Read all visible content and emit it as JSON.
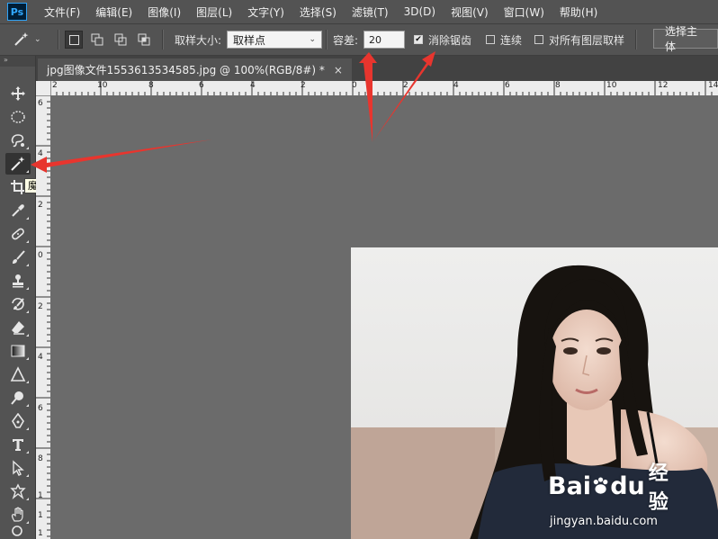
{
  "app": {
    "logo": "Ps"
  },
  "menu": [
    "文件(F)",
    "编辑(E)",
    "图像(I)",
    "图层(L)",
    "文字(Y)",
    "选择(S)",
    "滤镜(T)",
    "3D(D)",
    "视图(V)",
    "窗口(W)",
    "帮助(H)"
  ],
  "options": {
    "sample_size_label": "取样大小:",
    "sample_size_value": "取样点",
    "tolerance_label": "容差:",
    "tolerance_value": "20",
    "antialias_label": "消除锯齿",
    "antialias_checked": true,
    "contiguous_label": "连续",
    "contiguous_checked": false,
    "sample_all_layers_label": "对所有图层取样",
    "sample_all_layers_checked": false,
    "select_subject_label": "选择主体"
  },
  "tools_header": "»",
  "tooltip": "魔棒工具 (W)",
  "document": {
    "tab_title": "jpg图像文件1553613534585.jpg @ 100%(RGB/8#) *",
    "close": "×"
  },
  "ruler": {
    "h_labels": [
      "2",
      "10",
      "8",
      "6",
      "4",
      "2",
      "0",
      "2",
      "4",
      "6",
      "8",
      "10",
      "12",
      "14"
    ],
    "v_labels": [
      "6",
      "4",
      "2",
      "0",
      "2",
      "4",
      "6",
      "8",
      "1",
      "1",
      "1"
    ]
  },
  "watermark": {
    "brand": "Bai",
    "brand2": "du",
    "cn": "经验",
    "url": "jingyan.baidu.com"
  },
  "colors": {
    "panel": "#535353",
    "canvas": "#6b6b6b",
    "arrow": "#e8352e"
  }
}
